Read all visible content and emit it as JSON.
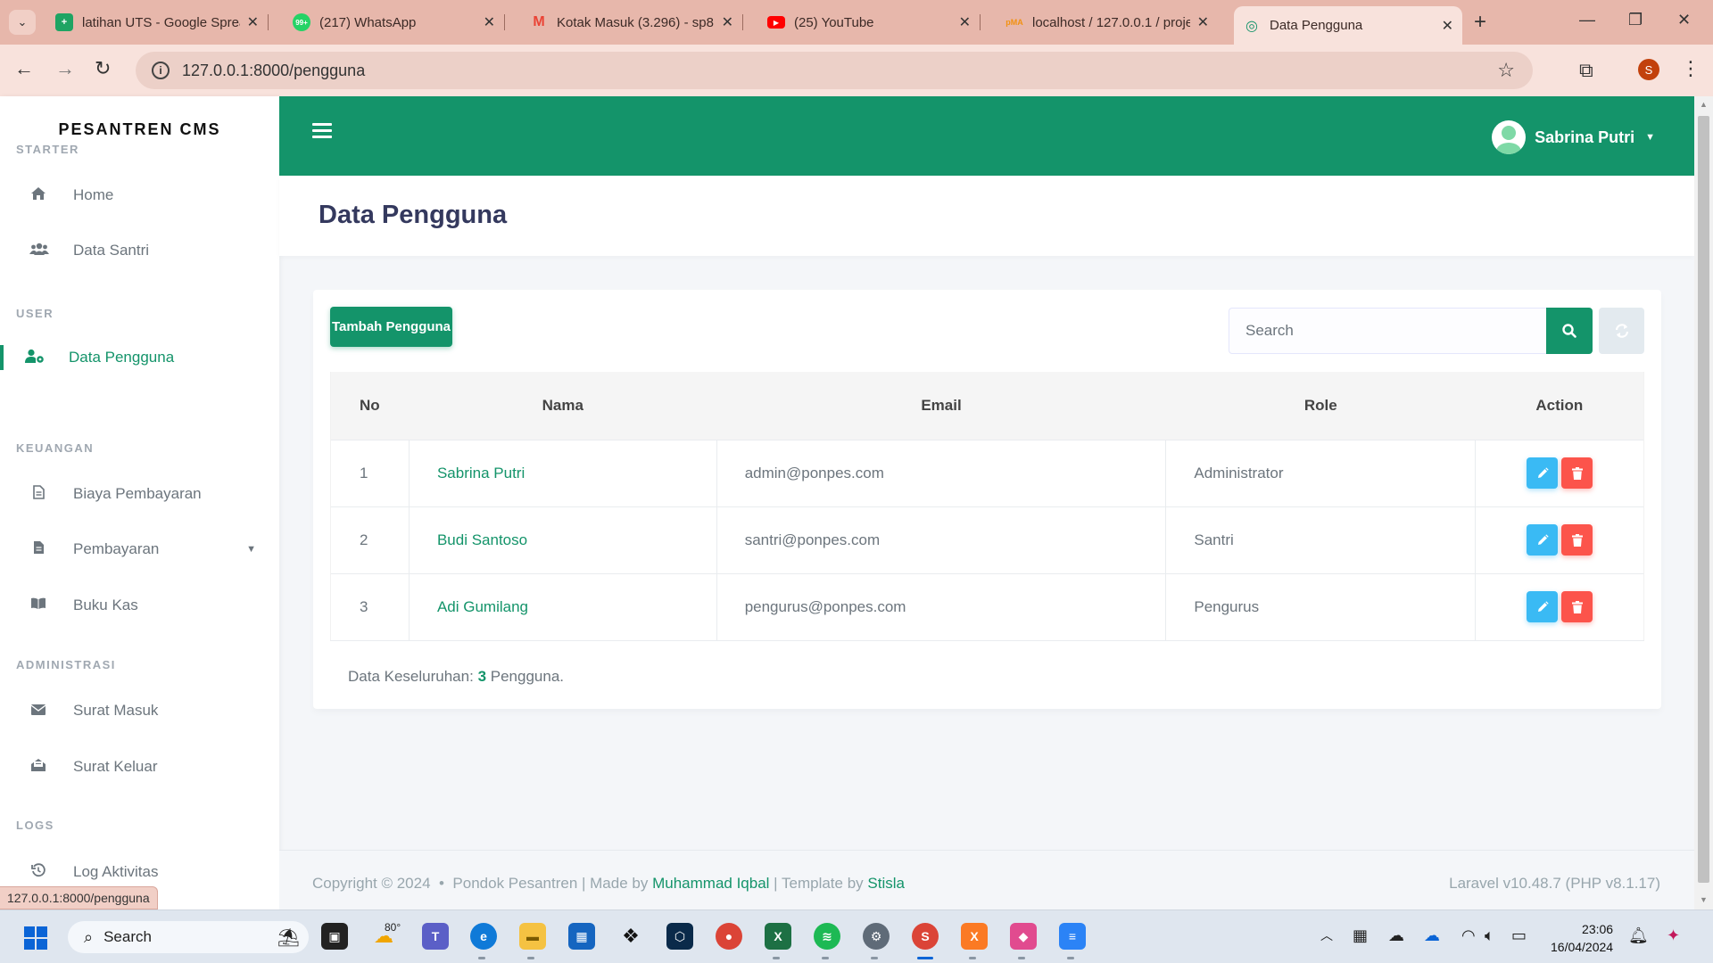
{
  "browser": {
    "tabs": [
      {
        "title": "latihan UTS - Google Sprea",
        "icon": "google-sheets-icon",
        "color": "#1fa463"
      },
      {
        "title": "(217) WhatsApp",
        "icon": "whatsapp-icon",
        "color": "#25d366"
      },
      {
        "title": "Kotak Masuk (3.296) - sp8",
        "icon": "gmail-icon",
        "color": "#ea4335"
      },
      {
        "title": "(25) YouTube",
        "icon": "youtube-icon",
        "color": "#ff0000"
      },
      {
        "title": "localhost / 127.0.0.1 / proje",
        "icon": "phpmyadmin-icon",
        "color": "#f29111"
      },
      {
        "title": "Data Pengguna",
        "icon": "globe-icon",
        "color": "#14946a"
      }
    ],
    "url": "127.0.0.1:8000/pengguna",
    "profile_initial": "S",
    "status_url": "127.0.0.1:8000/pengguna"
  },
  "sidebar": {
    "brand": "PESANTREN CMS",
    "sections": {
      "starter": "STARTER",
      "user": "USER",
      "keuangan": "KEUANGAN",
      "administrasi": "ADMINISTRASI",
      "logs": "LOGS"
    },
    "items": {
      "home": "Home",
      "data_santri": "Data Santri",
      "data_pengguna": "Data Pengguna",
      "biaya_pembayaran": "Biaya Pembayaran",
      "pembayaran": "Pembayaran",
      "buku_kas": "Buku Kas",
      "surat_masuk": "Surat Masuk",
      "surat_keluar": "Surat Keluar",
      "log_aktivitas": "Log Aktivitas"
    }
  },
  "topnav": {
    "user_name": "Sabrina Putri"
  },
  "page": {
    "title": "Data Pengguna",
    "add_button": "Tambah Pengguna",
    "search_placeholder": "Search",
    "table": {
      "headers": {
        "no": "No",
        "nama": "Nama",
        "email": "Email",
        "role": "Role",
        "action": "Action"
      },
      "rows": [
        {
          "no": "1",
          "nama": "Sabrina Putri",
          "email": "admin@ponpes.com",
          "role": "Administrator"
        },
        {
          "no": "2",
          "nama": "Budi Santoso",
          "email": "santri@ponpes.com",
          "role": "Santri"
        },
        {
          "no": "3",
          "nama": "Adi Gumilang",
          "email": "pengurus@ponpes.com",
          "role": "Pengurus"
        }
      ]
    },
    "summary": {
      "prefix": "Data Keseluruhan:",
      "count": "3",
      "suffix": "Pengguna."
    }
  },
  "footer": {
    "copyright": "Copyright © 2024",
    "separator": "•",
    "org": "Pondok Pesantren | Made by",
    "author": "Muhammad Iqbal",
    "template_prefix": "| Template by",
    "template": "Stisla",
    "version": "Laravel v10.48.7 (PHP v8.1.17)"
  },
  "taskbar": {
    "search_label": "Search",
    "weather_temp": "80°",
    "time": "23:06",
    "date": "16/04/2024"
  },
  "colors": {
    "primary": "#14946a",
    "info": "#3abaf4",
    "danger": "#fc544b",
    "tabbar": "#e7b7ab"
  }
}
